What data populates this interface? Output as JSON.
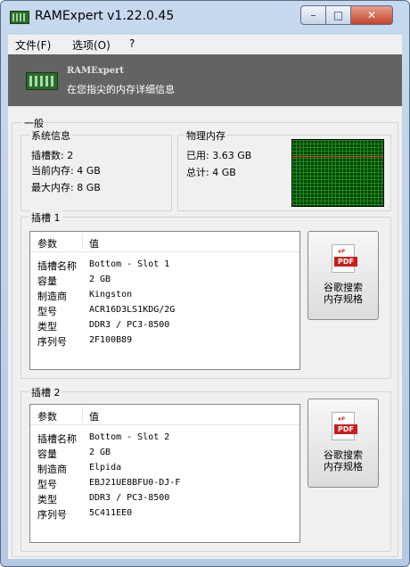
{
  "window": {
    "title": "RAMExpert v1.22.0.45"
  },
  "menu": {
    "file": "文件(F)",
    "options": "选项(O)",
    "help": "?"
  },
  "banner": {
    "title": "RAMExpert",
    "subtitle": "在您指尖的内存详细信息"
  },
  "general": {
    "label": "一般",
    "system_info": {
      "label": "系统信息",
      "slots": "插槽数: 2",
      "current_memory": "当前内存: 4 GB",
      "max_memory": "最大内存: 8 GB"
    },
    "physical_memory": {
      "label": "物理内存",
      "used": "已用: 3.63 GB",
      "total": "总计: 4 GB",
      "usage_fraction": 0.9075
    }
  },
  "columns": {
    "param": "参数",
    "value": "值"
  },
  "slots": [
    {
      "label": "插槽 1",
      "rows": [
        {
          "key": "插槽名称",
          "value": "Bottom - Slot 1"
        },
        {
          "key": "容量",
          "value": "2 GB"
        },
        {
          "key": "制造商",
          "value": "Kingston"
        },
        {
          "key": "型号",
          "value": "ACR16D3LS1KDG/2G"
        },
        {
          "key": "类型",
          "value": "DDR3 / PC3-8500"
        },
        {
          "key": "序列号",
          "value": "2F100B89"
        }
      ],
      "button": {
        "line1": "谷歌搜索",
        "line2": "内存规格",
        "badge": "PDF"
      }
    },
    {
      "label": "插槽 2",
      "rows": [
        {
          "key": "插槽名称",
          "value": "Bottom - Slot 2"
        },
        {
          "key": "容量",
          "value": "2 GB"
        },
        {
          "key": "制造商",
          "value": "Elpida"
        },
        {
          "key": "型号",
          "value": "EBJ21UE8BFU0-DJ-F"
        },
        {
          "key": "类型",
          "value": "DDR3 / PC3-8500"
        },
        {
          "key": "序列号",
          "value": "5C411EE0"
        }
      ],
      "button": {
        "line1": "谷歌搜索",
        "line2": "内存规格",
        "badge": "PDF"
      }
    }
  ],
  "icons": {
    "app": "ram-module-icon",
    "pdf": "pdf-document-icon"
  }
}
